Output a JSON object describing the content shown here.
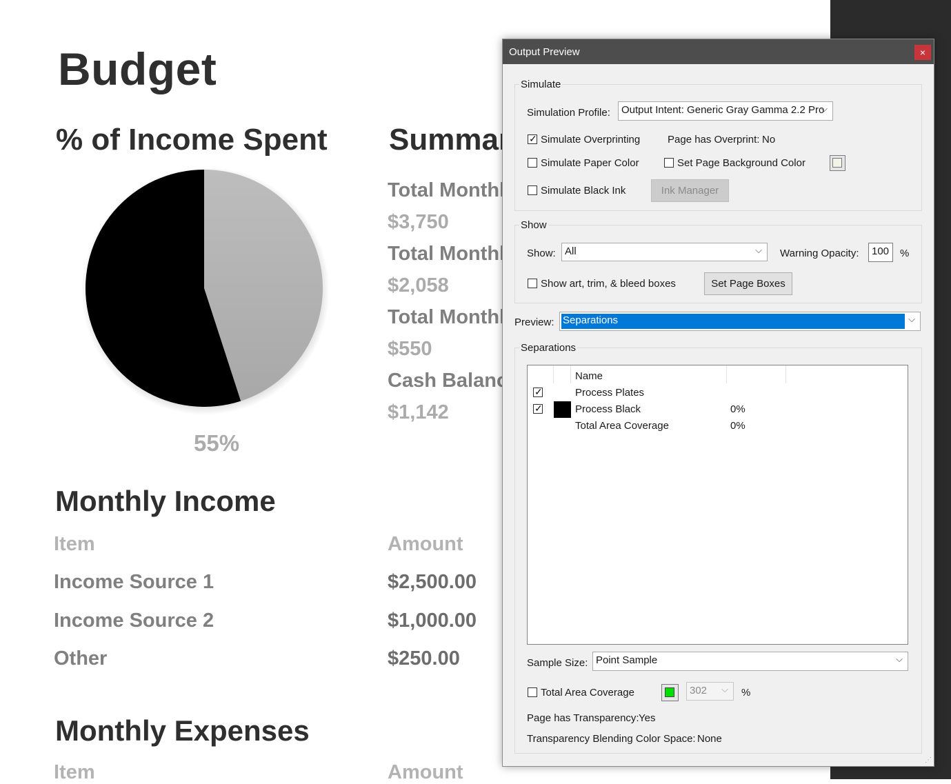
{
  "document": {
    "title": "Budget",
    "pie_heading": "% of Income Spent",
    "pie_percent": "55%",
    "summary_heading": "Summar",
    "summary": [
      {
        "label": "Total Monthl",
        "value": "$3,750"
      },
      {
        "label": "Total Monthl",
        "value": "$2,058"
      },
      {
        "label": "Total Monthl",
        "value": "$550"
      },
      {
        "label": "Cash Balanc",
        "value": "$1,142"
      }
    ],
    "income": {
      "heading": "Monthly Income",
      "col_item": "Item",
      "col_amount": "Amount",
      "rows": [
        {
          "item": "Income Source 1",
          "amount": "$2,500.00"
        },
        {
          "item": "Income Source 2",
          "amount": "$1,000.00"
        },
        {
          "item": "Other",
          "amount": "$250.00"
        }
      ]
    },
    "expenses": {
      "heading": "Monthly Expenses",
      "col_item": "Item",
      "col_amount": "Amount"
    }
  },
  "chart_data": {
    "type": "pie",
    "values": [
      55,
      45
    ],
    "colors": [
      "#000000",
      "#b0b0b0"
    ]
  },
  "dialog": {
    "title": "Output Preview",
    "close_glyph": "×",
    "simulate": {
      "group_label": "Simulate",
      "profile_label": "Simulation Profile:",
      "profile_value": "Output Intent: Generic Gray Gamma 2.2 Pro",
      "overprint_label": "Simulate Overprinting",
      "overprint_checked": true,
      "page_overprint_label": "Page has Overprint:",
      "page_overprint_value": "No",
      "paper_color_label": "Simulate Paper Color",
      "bg_color_label": "Set Page Background Color",
      "black_ink_label": "Simulate Black Ink",
      "ink_manager_label": "Ink Manager"
    },
    "show": {
      "group_label": "Show",
      "show_label": "Show:",
      "show_value": "All",
      "opacity_label": "Warning Opacity:",
      "opacity_value": "100",
      "opacity_unit": "%",
      "boxes_label": "Show art, trim, & bleed boxes",
      "set_boxes_label": "Set Page Boxes"
    },
    "preview": {
      "label": "Preview:",
      "value": "Separations",
      "highlight_color": "#0078d7"
    },
    "separations": {
      "group_label": "Separations",
      "col_name": "Name",
      "rows": [
        {
          "name": "Process Plates",
          "checked": true,
          "swatch": false,
          "value": ""
        },
        {
          "name": "Process Black",
          "checked": true,
          "swatch": true,
          "value": "0%"
        },
        {
          "name": "Total Area Coverage",
          "checked": false,
          "swatch": false,
          "value": "0%"
        }
      ]
    },
    "sample": {
      "label": "Sample Size:",
      "value": "Point Sample"
    },
    "tac": {
      "label": "Total Area Coverage",
      "value": "302",
      "unit": "%"
    },
    "transparency_label": "Page has Transparency:",
    "transparency_value": "Yes",
    "blend_label": "Transparency Blending Color Space:",
    "blend_value": "None"
  }
}
